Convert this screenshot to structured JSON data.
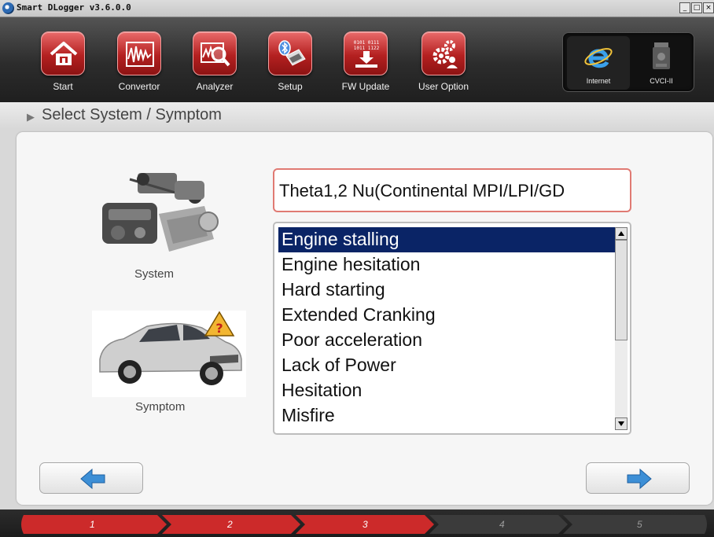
{
  "window": {
    "title": "Smart DLogger v3.6.0.0",
    "controls": [
      "_",
      "□",
      "×"
    ]
  },
  "toolbar": {
    "buttons": [
      {
        "label": "Start",
        "icon": "home-icon"
      },
      {
        "label": "Convertor",
        "icon": "waveform-icon"
      },
      {
        "label": "Analyzer",
        "icon": "magnifier-chart-icon"
      },
      {
        "label": "Setup",
        "icon": "bluetooth-device-icon"
      },
      {
        "label": "FW Update",
        "icon": "firmware-download-icon",
        "icon_text": [
          "0101 0111",
          "1011 1122"
        ]
      },
      {
        "label": "User Option",
        "icon": "gears-user-icon"
      }
    ],
    "connections": [
      {
        "label": "Internet",
        "icon": "internet-explorer-icon",
        "active": true
      },
      {
        "label": "CVCI-II",
        "icon": "vci-device-icon",
        "active": false
      }
    ]
  },
  "header": {
    "title": "Select System / Symptom"
  },
  "system": {
    "label": "System",
    "selected_value": "Theta1,2 Nu(Continental MPI/LPI/GD"
  },
  "symptom": {
    "label": "Symptom",
    "items": [
      "Engine stalling",
      "Engine hesitation",
      "Hard starting",
      "Extended Cranking",
      "Poor acceleration",
      "Lack of Power",
      "Hesitation",
      "Misfire"
    ],
    "selected_index": 0
  },
  "navigation": {
    "back_icon": "arrow-left-icon",
    "next_icon": "arrow-right-icon"
  },
  "progress": {
    "steps": [
      "1",
      "2",
      "3",
      "4",
      "5"
    ],
    "current_step": 3
  },
  "colors": {
    "selection": "#0a2466",
    "tool_red": "#b42020",
    "field_border": "#e07a73",
    "arrow_blue": "#3d8fd6"
  }
}
